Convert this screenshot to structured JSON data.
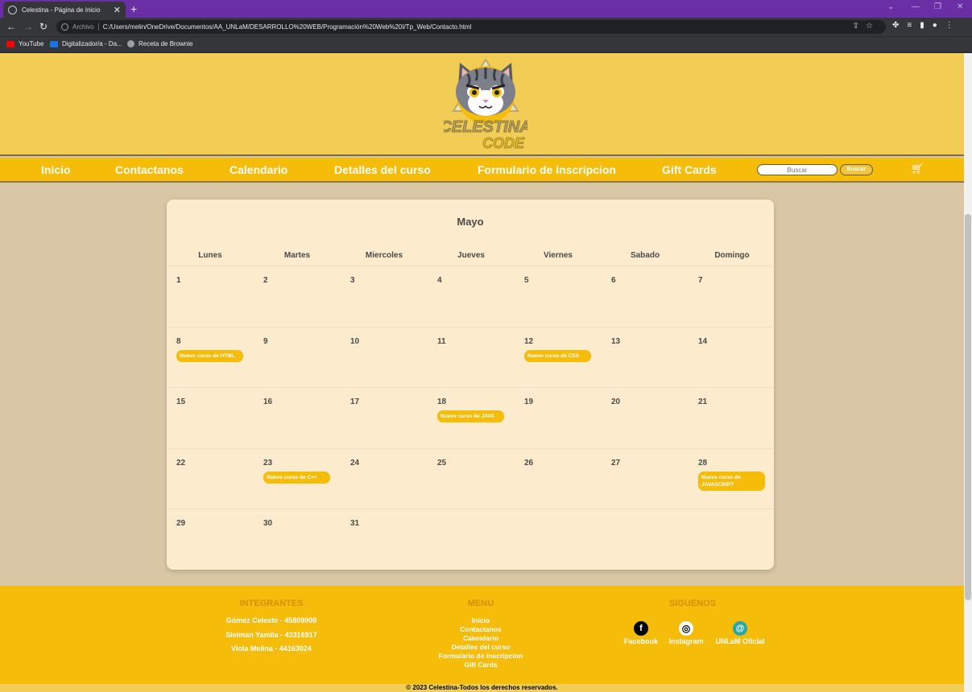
{
  "browser": {
    "tab_title": "Celestina - Página de Inicio",
    "address_label": "Archivo",
    "url": "C:/Users/melin/OneDrive/Documentos/AA_UNLaM/DESARROLLO%20WEB/Programación%20Web%20I/Tp_Web/Contacto.html",
    "bookmarks": [
      {
        "label": "YouTube",
        "icon": "youtube-icon",
        "color": "#ff0000"
      },
      {
        "label": "Digitalizador/a - Da...",
        "icon": "digitalizador-icon",
        "color": "#1a73e8"
      },
      {
        "label": "Receta de Brownie",
        "icon": "globe-icon",
        "color": "#9aa0a6"
      }
    ]
  },
  "site": {
    "logo_text": "CELESTINA CODE",
    "nav": [
      "Inicio",
      "Contactanos",
      "Calendario",
      "Detalles del curso",
      "Formulario de inscripcion",
      "Gift Cards"
    ],
    "search_placeholder": "Buscar",
    "search_button": "Buscar",
    "colors": {
      "header": "#f2cd56",
      "nav": "#f5bc0a",
      "background": "#d9c6a5",
      "calendar": "#fdebcd"
    }
  },
  "calendar": {
    "month": "Mayo",
    "weekdays": [
      "Lunes",
      "Martes",
      "Miercoles",
      "Jueves",
      "Viernes",
      "Sabado",
      "Domingo"
    ],
    "weeks": [
      [
        {
          "day": "1"
        },
        {
          "day": "2"
        },
        {
          "day": "3"
        },
        {
          "day": "4"
        },
        {
          "day": "5"
        },
        {
          "day": "6"
        },
        {
          "day": "7"
        }
      ],
      [
        {
          "day": "8",
          "event": "Nuevo curso de HTML"
        },
        {
          "day": "9"
        },
        {
          "day": "10"
        },
        {
          "day": "11"
        },
        {
          "day": "12",
          "event": "Nuevo curso de CSS"
        },
        {
          "day": "13"
        },
        {
          "day": "14"
        }
      ],
      [
        {
          "day": "15"
        },
        {
          "day": "16"
        },
        {
          "day": "17"
        },
        {
          "day": "18",
          "event": "Nuevo curso de JAVA"
        },
        {
          "day": "19"
        },
        {
          "day": "20"
        },
        {
          "day": "21"
        }
      ],
      [
        {
          "day": "22"
        },
        {
          "day": "23",
          "event": "Nuevo curso de C++"
        },
        {
          "day": "24"
        },
        {
          "day": "25"
        },
        {
          "day": "26"
        },
        {
          "day": "27"
        },
        {
          "day": "28",
          "event": "Nuevo curso de JAVASCRIPT"
        }
      ],
      [
        {
          "day": "29"
        },
        {
          "day": "30"
        },
        {
          "day": "31"
        }
      ]
    ]
  },
  "footer": {
    "integrantes_title": "INTEGRANTES",
    "integrantes": [
      "Gómez Celeste - 45809908",
      "Sleiman Yamila - 43316917",
      "Viola Melina - 44163024"
    ],
    "menu_title": "MENU",
    "menu": [
      "Inicio",
      "Contactanos",
      "Calendario",
      "Detalles del curso",
      "Formulario de inscripcion",
      "Gift Cards"
    ],
    "social_title": "SIGUENOS",
    "social": [
      {
        "label": "Facebook",
        "icon": "facebook-icon",
        "glyph": "f"
      },
      {
        "label": "Instagram",
        "icon": "instagram-icon",
        "glyph": "◎"
      },
      {
        "label": "UNLaM Oficial",
        "icon": "unlam-icon",
        "glyph": "@"
      }
    ],
    "copyright": "© 2023 Celestina-Todos los derechos reservados."
  }
}
